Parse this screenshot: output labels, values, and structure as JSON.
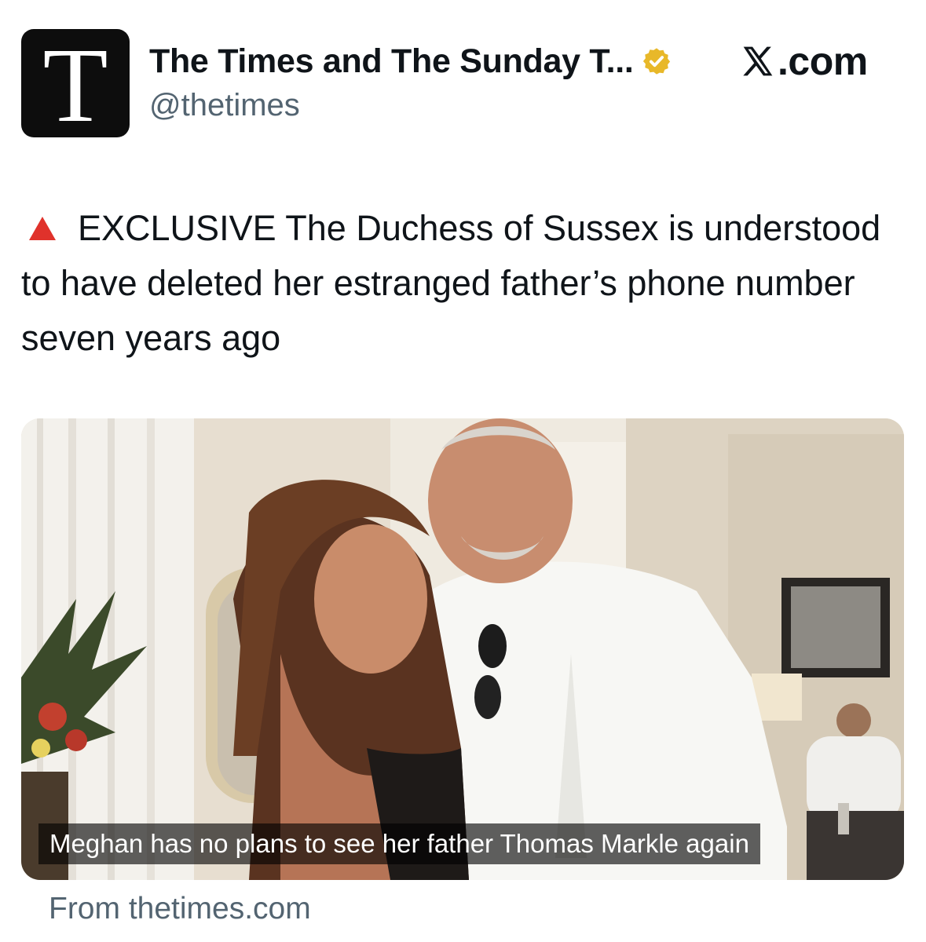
{
  "account": {
    "display_name": "The Times and The Sunday T...",
    "handle": "@thetimes",
    "avatar_letter": "T",
    "verified_badge_icon": "gold-verified-badge-icon",
    "verified_color": "#e8b829"
  },
  "platform": {
    "logo_icon": "x-logo-icon",
    "label": ".com"
  },
  "tweet": {
    "marker_icon": "red-triangle-icon",
    "marker_color": "#e0322b",
    "text": "EXCLUSIVE The Duchess of Sussex is understood to have deleted her estranged father’s phone number seven years ago"
  },
  "media": {
    "caption": "Meghan has no plans to see her father Thomas Markle again"
  },
  "link_source": {
    "text": "From thetimes.com"
  }
}
